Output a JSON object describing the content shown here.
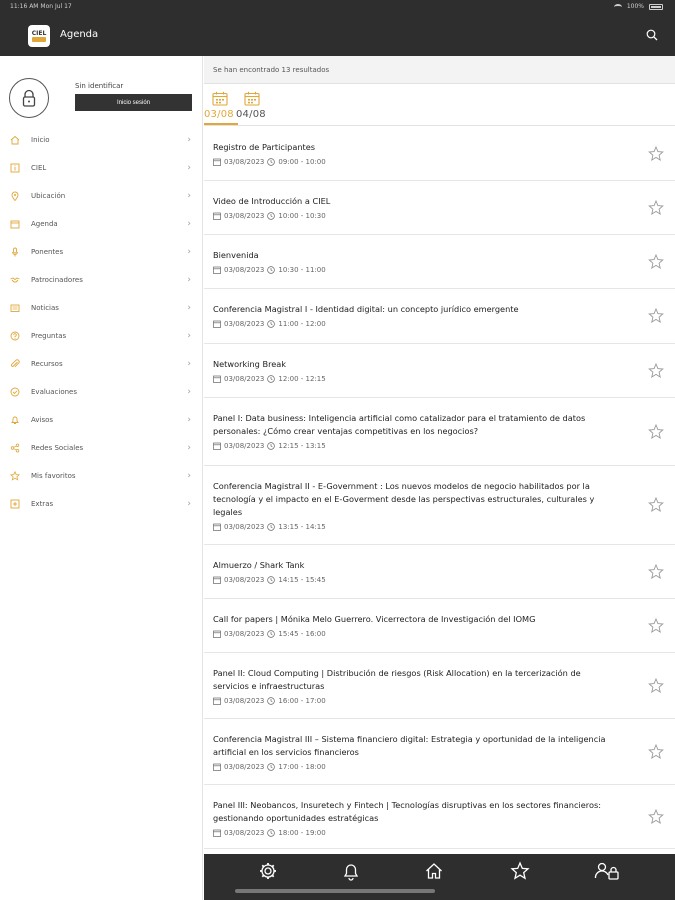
{
  "status_bar": {
    "time": "11:16 AM   Mon Jul 17",
    "battery": "100%"
  },
  "header": {
    "logo_text": "CIEL",
    "title": "Agenda"
  },
  "sidebar": {
    "user_status": "Sin identificar",
    "login_label": "Inicio sesión",
    "items": [
      {
        "label": "Inicio",
        "icon": "home-icon"
      },
      {
        "label": "CIEL",
        "icon": "info-icon"
      },
      {
        "label": "Ubicación",
        "icon": "location-pin-icon"
      },
      {
        "label": "Agenda",
        "icon": "calendar-icon"
      },
      {
        "label": "Ponentes",
        "icon": "microphone-icon"
      },
      {
        "label": "Patrocinadores",
        "icon": "handshake-icon"
      },
      {
        "label": "Noticias",
        "icon": "newspaper-icon"
      },
      {
        "label": "Preguntas",
        "icon": "question-icon"
      },
      {
        "label": "Recursos",
        "icon": "paperclip-icon"
      },
      {
        "label": "Evaluaciones",
        "icon": "checkmark-icon"
      },
      {
        "label": "Avisos",
        "icon": "bell-icon"
      },
      {
        "label": "Redes Sociales",
        "icon": "share-icon"
      },
      {
        "label": "Mis favoritos",
        "icon": "star-icon"
      },
      {
        "label": "Extras",
        "icon": "plus-box-icon"
      }
    ]
  },
  "main": {
    "results_text": "Se han encontrado 13 resultados",
    "date_tabs": [
      {
        "label": "03/08",
        "active": true
      },
      {
        "label": "04/08",
        "active": false
      }
    ],
    "events": [
      {
        "title": "Registro de Participantes",
        "date": "03/08/2023",
        "time": "09:00 - 10:00"
      },
      {
        "title": "Video de Introducción a CIEL",
        "date": "03/08/2023",
        "time": "10:00 - 10:30"
      },
      {
        "title": "Bienvenida",
        "date": "03/08/2023",
        "time": "10:30 - 11:00"
      },
      {
        "title": "Conferencia Magistral I - Identidad digital: un concepto jurídico emergente",
        "date": "03/08/2023",
        "time": "11:00 - 12:00"
      },
      {
        "title": "Networking Break",
        "date": "03/08/2023",
        "time": "12:00 - 12:15"
      },
      {
        "title": "Panel I: Data business: Inteligencia artificial como catalizador para el tratamiento de datos personales: ¿Cómo crear ventajas competitivas en los negocios?",
        "date": "03/08/2023",
        "time": "12:15 - 13:15"
      },
      {
        "title": "Conferencia Magistral II - E-Government : Los nuevos modelos de negocio habilitados por la tecnología y el impacto en el E-Goverment desde las perspectivas estructurales, culturales y legales",
        "date": "03/08/2023",
        "time": "13:15 - 14:15"
      },
      {
        "title": "Almuerzo / Shark Tank",
        "date": "03/08/2023",
        "time": "14:15 - 15:45"
      },
      {
        "title": "Call for papers | Mónika Melo Guerrero. Vicerrectora de Investigación del IOMG",
        "date": "03/08/2023",
        "time": "15:45 - 16:00"
      },
      {
        "title": "Panel II: Cloud Computing | Distribución de riesgos (Risk Allocation) en la tercerización de servicios e infraestructuras",
        "date": "03/08/2023",
        "time": "16:00 - 17:00"
      },
      {
        "title": "Conferencia Magistral III – Sistema financiero digital: Estrategia y oportunidad de la inteligencia artificial en los servicios financieros",
        "date": "03/08/2023",
        "time": "17:00 - 18:00"
      },
      {
        "title": "Panel III: Neobancos, Insuretech y Fintech | Tecnologías disruptivas en los sectores financieros: gestionando oportunidades estratégicas",
        "date": "03/08/2023",
        "time": "18:00 - 19:00"
      }
    ]
  },
  "bottom_bar": [
    {
      "icon": "gear-icon"
    },
    {
      "icon": "bell-icon"
    },
    {
      "icon": "home-icon"
    },
    {
      "icon": "star-icon"
    },
    {
      "icon": "user-lock-icon"
    }
  ],
  "colors": {
    "bar": "#2e2e2e",
    "accent": "#e0a73a",
    "text": "#222222"
  }
}
